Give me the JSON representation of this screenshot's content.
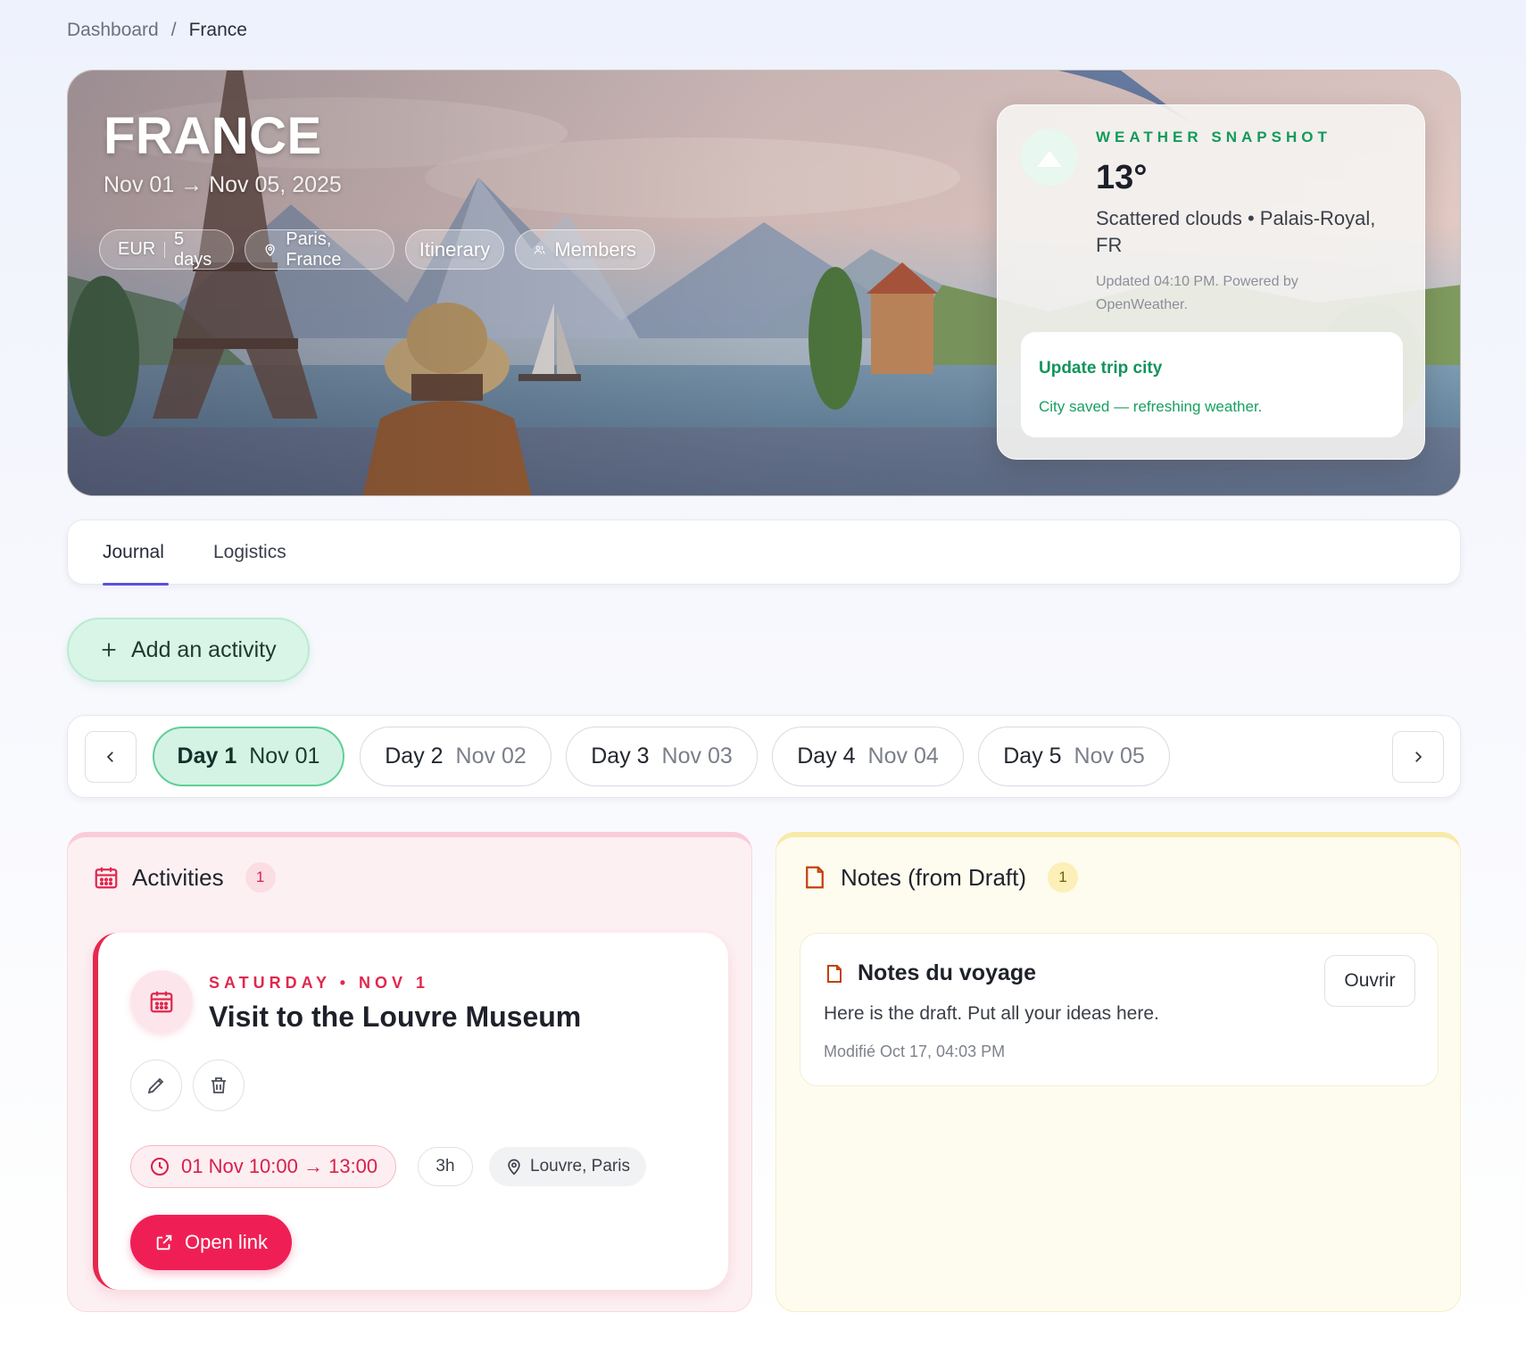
{
  "breadcrumb": {
    "root": "Dashboard",
    "separator": "/",
    "current": "France"
  },
  "hero": {
    "title": "FRANCE",
    "dates": "Nov 01 → Nov 05, 2025",
    "currency": "EUR",
    "duration": "5 days",
    "location": "Paris, France",
    "itinerary_label": "Itinerary",
    "members_label": "Members"
  },
  "weather": {
    "label": "WEATHER SNAPSHOT",
    "temp": "13°",
    "description": "Scattered clouds • Palais-Royal, FR",
    "updated": "Updated 04:10 PM. Powered by OpenWeather.",
    "update_city_label": "Update trip city",
    "status_message": "City saved — refreshing weather.",
    "accent": "#139a5b"
  },
  "tabs": [
    {
      "label": "Journal",
      "active": true
    },
    {
      "label": "Logistics",
      "active": false
    }
  ],
  "add_activity_label": "Add an activity",
  "days": [
    {
      "day": "Day 1",
      "date": "Nov 01",
      "active": true
    },
    {
      "day": "Day 2",
      "date": "Nov 02",
      "active": false
    },
    {
      "day": "Day 3",
      "date": "Nov 03",
      "active": false
    },
    {
      "day": "Day 4",
      "date": "Nov 04",
      "active": false
    },
    {
      "day": "Day 5",
      "date": "Nov 05",
      "active": false
    }
  ],
  "activities": {
    "title": "Activities",
    "count": "1",
    "item": {
      "when": "SATURDAY • NOV 1",
      "title": "Visit to the Louvre Museum",
      "time": "01 Nov 10:00 → 13:00",
      "duration": "3h",
      "location": "Louvre, Paris",
      "open_link_label": "Open link"
    },
    "accent": "#e7284f"
  },
  "notes": {
    "title": "Notes (from Draft)",
    "count": "1",
    "item": {
      "title": "Notes du voyage",
      "body": "Here is the draft. Put all your ideas here.",
      "modified": "Modifié Oct 17, 04:03 PM",
      "open_label": "Ouvrir"
    },
    "accent": "#c2410c"
  },
  "icons": [
    "location-pin-icon",
    "users-icon",
    "cloud-icon",
    "plus-icon",
    "chevron-left-icon",
    "chevron-right-icon",
    "calendar-icon",
    "document-icon",
    "pencil-icon",
    "trash-icon",
    "clock-icon",
    "external-link-icon"
  ]
}
